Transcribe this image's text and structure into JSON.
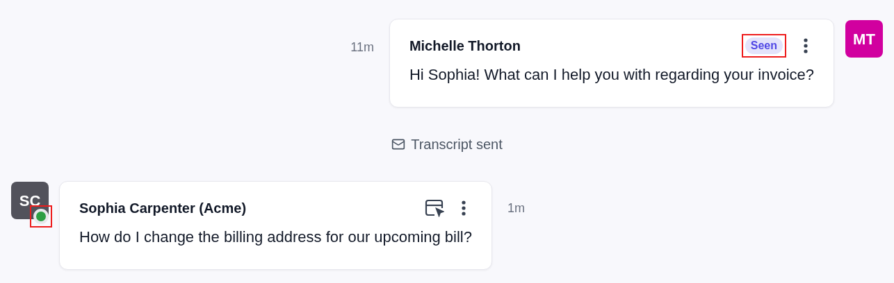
{
  "messages": [
    {
      "kind": "outgoing",
      "time": "11m",
      "author": "Michelle Thorton",
      "status": {
        "label": "Seen",
        "highlighted": true
      },
      "text": "Hi Sophia! What can I help you with regarding your invoice?",
      "avatar": {
        "initials": "MT",
        "color": "#d1009f"
      }
    },
    {
      "kind": "event",
      "text": "Transcript sent"
    },
    {
      "kind": "incoming",
      "time": "1m",
      "author": "Sophia Carpenter (Acme)",
      "text": "How do I change the billing address for our upcoming bill?",
      "avatar": {
        "initials": "SC",
        "color": "#52525b",
        "online": true,
        "highlighted": true
      }
    }
  ]
}
